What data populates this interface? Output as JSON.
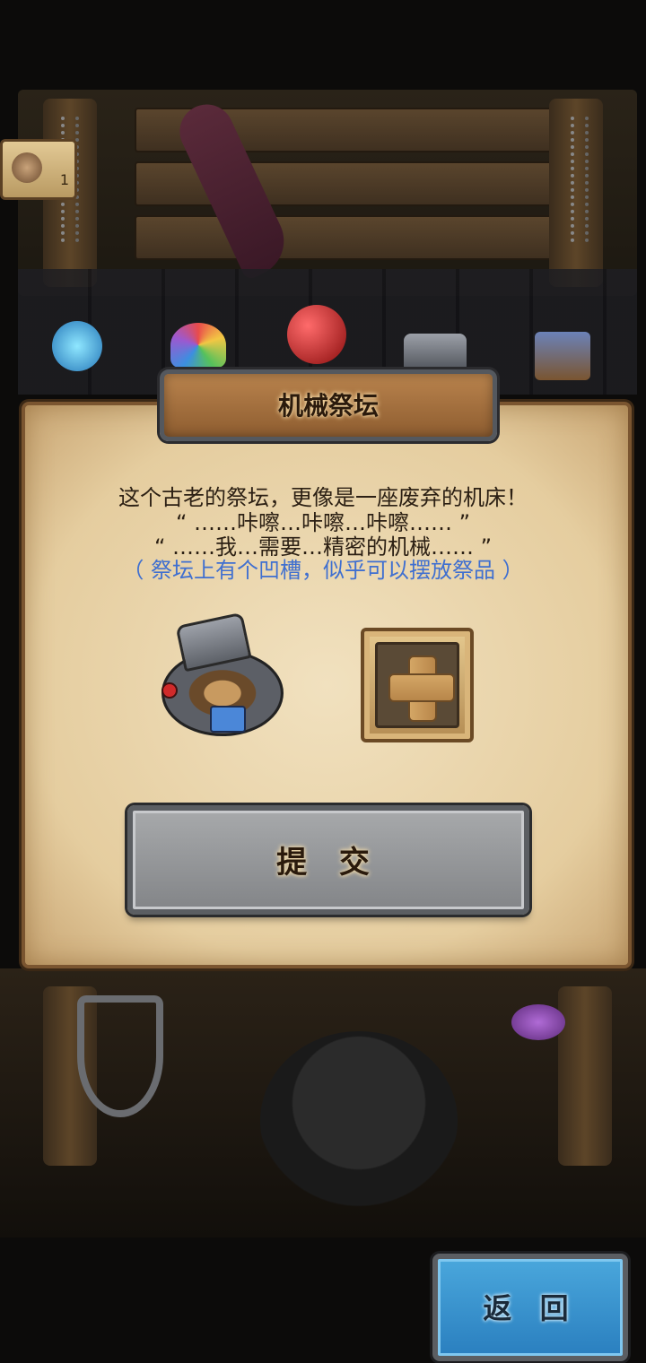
{
  "hud": {
    "item_count": "1"
  },
  "dialog": {
    "title": "机械祭坛",
    "lines": [
      "这个古老的祭坛，更像是一座废弃的机床！",
      "“ ……咔嚓…咔嚓…咔嚓…… ”",
      "“ ……我…需要…精密的机械…… ”"
    ],
    "hint": "（ 祭坛上有个凹槽，似乎可以摆放祭品 ）",
    "submit_label": "提 交"
  },
  "icons": {
    "altar": "mechanical-altar-icon",
    "add_slot": "plus-icon"
  },
  "back_label": "返 回",
  "colors": {
    "hint_text": "#3f6fd0",
    "back_button": "#3a94d0",
    "panel": "#ecd8b0"
  }
}
